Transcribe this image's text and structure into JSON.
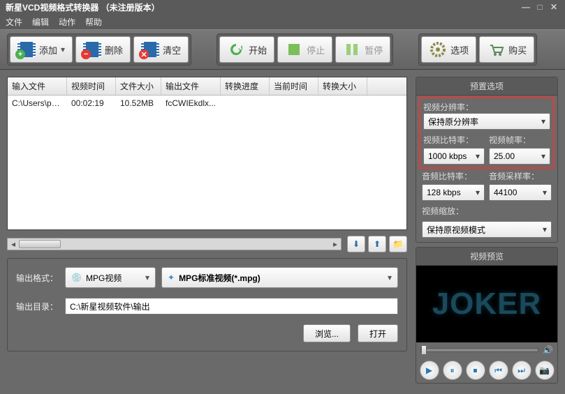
{
  "titlebar": {
    "title": "新星VCD视频格式转换器  （未注册版本）"
  },
  "menu": {
    "file": "文件",
    "edit": "编辑",
    "action": "动作",
    "help": "帮助"
  },
  "toolbar": {
    "add": "添加",
    "delete": "删除",
    "clear": "清空",
    "start": "开始",
    "stop": "停止",
    "pause": "暂停",
    "options": "选项",
    "buy": "购买"
  },
  "table": {
    "headers": [
      "输入文件",
      "视频时间",
      "文件大小",
      "输出文件",
      "转换进度",
      "当前时间",
      "转换大小"
    ],
    "rows": [
      {
        "input": "C:\\Users\\pc\\...",
        "duration": "00:02:19",
        "size": "10.52MB",
        "output": "fcCWIEkdlx...",
        "progress": "",
        "time": "",
        "osize": ""
      }
    ]
  },
  "output": {
    "format_label": "输出格式：",
    "format_main": "MPG视频",
    "format_sub": "MPG标准视频(*.mpg)",
    "dir_label": "输出目录：",
    "dir_value": "C:\\新星视频软件\\输出",
    "browse": "浏览...",
    "open": "打开"
  },
  "presets": {
    "title": "预置选项",
    "resolution_label": "视频分辨率：",
    "resolution_value": "保持原分辨率",
    "vbitrate_label": "视频比特率：",
    "vbitrate_value": "1000 kbps",
    "vfps_label": "视频帧率：",
    "vfps_value": "25.00",
    "abitrate_label": "音频比特率：",
    "abitrate_value": "128 kbps",
    "asample_label": "音频采样率：",
    "asample_value": "44100",
    "scale_label": "视频缩放：",
    "scale_value": "保持原视频模式"
  },
  "preview": {
    "title": "视频预览",
    "placeholder": "JOKER"
  }
}
